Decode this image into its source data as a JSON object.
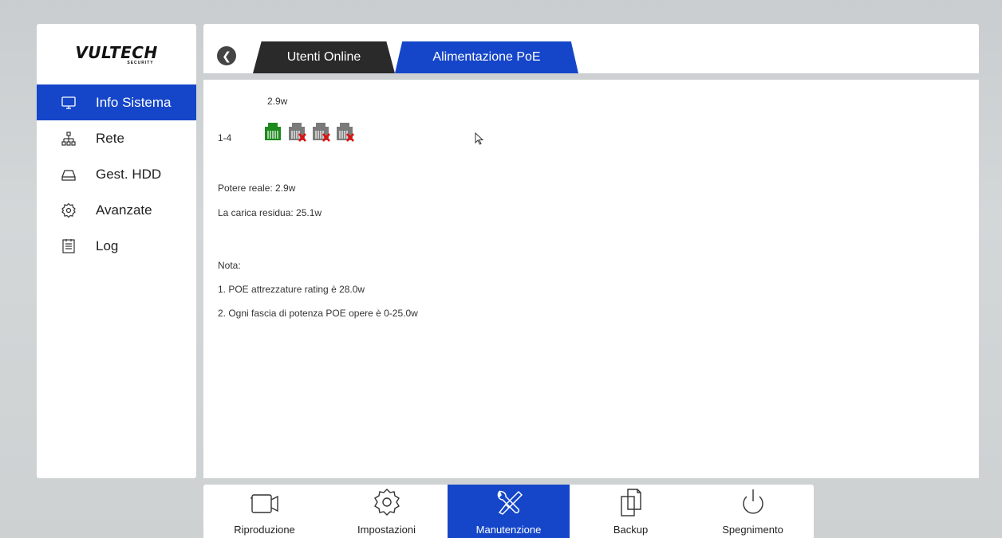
{
  "brand": {
    "logo": "VULTECH",
    "logo_sub": "SECURITY"
  },
  "sidebar": {
    "items": [
      {
        "label": "Info Sistema",
        "icon": "monitor-icon",
        "active": true
      },
      {
        "label": "Rete",
        "icon": "network-icon",
        "active": false
      },
      {
        "label": "Gest. HDD",
        "icon": "hdd-icon",
        "active": false
      },
      {
        "label": "Avanzate",
        "icon": "gear-icon",
        "active": false
      },
      {
        "label": "Log",
        "icon": "log-icon",
        "active": false
      }
    ]
  },
  "tabs": [
    {
      "label": "Utenti Online",
      "active": false
    },
    {
      "label": "Alimentazione PoE",
      "active": true
    }
  ],
  "poe": {
    "port_power": "2.9w",
    "port_range": "1-4",
    "ports": [
      {
        "state": "active",
        "color": "#1c8a1c"
      },
      {
        "state": "disconnected",
        "color": "#7a7a7a"
      },
      {
        "state": "disconnected",
        "color": "#7a7a7a"
      },
      {
        "state": "disconnected",
        "color": "#7a7a7a"
      }
    ],
    "real_power": "Potere reale:  2.9w",
    "remaining": "La carica residua:  25.1w",
    "note_title": "Nota:",
    "note_1": "1. POE attrezzature rating è 28.0w",
    "note_2": "2. Ogni fascia di potenza POE opere è 0-25.0w"
  },
  "bottombar": {
    "items": [
      {
        "label": "Riproduzione",
        "icon": "camera-icon",
        "active": false
      },
      {
        "label": "Impostazioni",
        "icon": "gear-icon",
        "active": false
      },
      {
        "label": "Manutenzione",
        "icon": "tools-icon",
        "active": true
      },
      {
        "label": "Backup",
        "icon": "copy-icon",
        "active": false
      },
      {
        "label": "Spegnimento",
        "icon": "power-icon",
        "active": false
      }
    ]
  },
  "colors": {
    "accent": "#1546c9",
    "tab_dark": "#2a2a2a"
  }
}
